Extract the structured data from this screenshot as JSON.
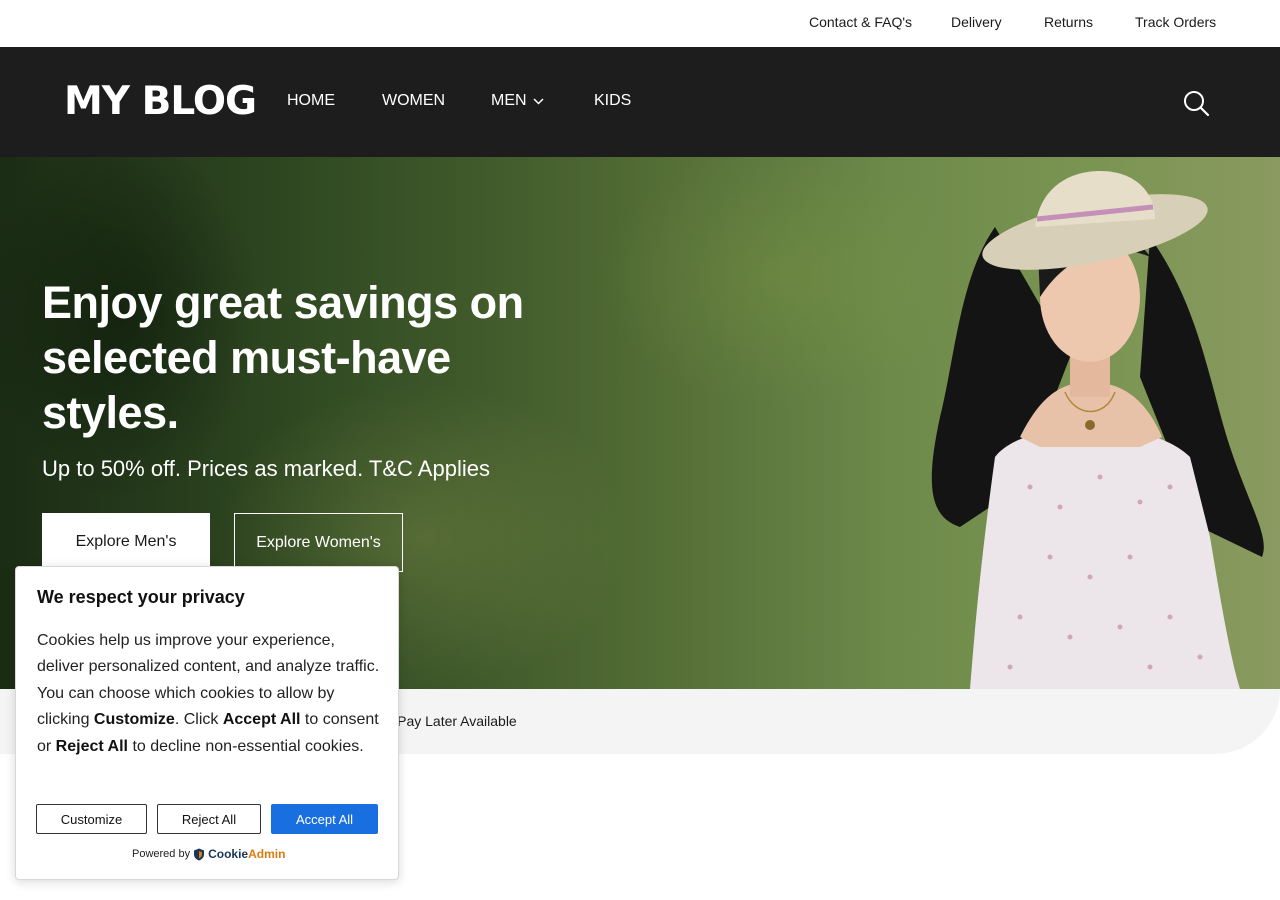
{
  "topbar": {
    "links": [
      "Contact & FAQ's",
      "Delivery",
      "Returns",
      "Track Orders"
    ]
  },
  "header": {
    "logo": "MY BLOG",
    "nav": [
      {
        "label": "HOME"
      },
      {
        "label": "WOMEN"
      },
      {
        "label": "MEN",
        "has_dropdown": true
      },
      {
        "label": "KIDS"
      }
    ],
    "search_icon": "search-icon"
  },
  "hero": {
    "title": "Enjoy great savings on selected must-have styles.",
    "subtitle": "Up to 50% off. Prices as marked. T&C Applies",
    "buttons": [
      "Explore Men's",
      "Explore Women's"
    ]
  },
  "promo": {
    "text": "w, Pay Later Available"
  },
  "cookie_banner": {
    "title": "We respect your privacy",
    "body_parts": [
      "Cookies help us improve your experience, deliver personalized content, and analyze traffic. You can choose which cookies to allow by clicking ",
      "Customize",
      ". Click ",
      "Accept All",
      " to consent or ",
      "Reject All",
      " to decline non-essential cookies."
    ],
    "buttons": {
      "customize": "Customize",
      "reject": "Reject All",
      "accept": "Accept All"
    },
    "powered_by": "Powered by",
    "brand_a": "Cookie",
    "brand_b": "Admin",
    "accent_color": "#1a6fe0"
  }
}
